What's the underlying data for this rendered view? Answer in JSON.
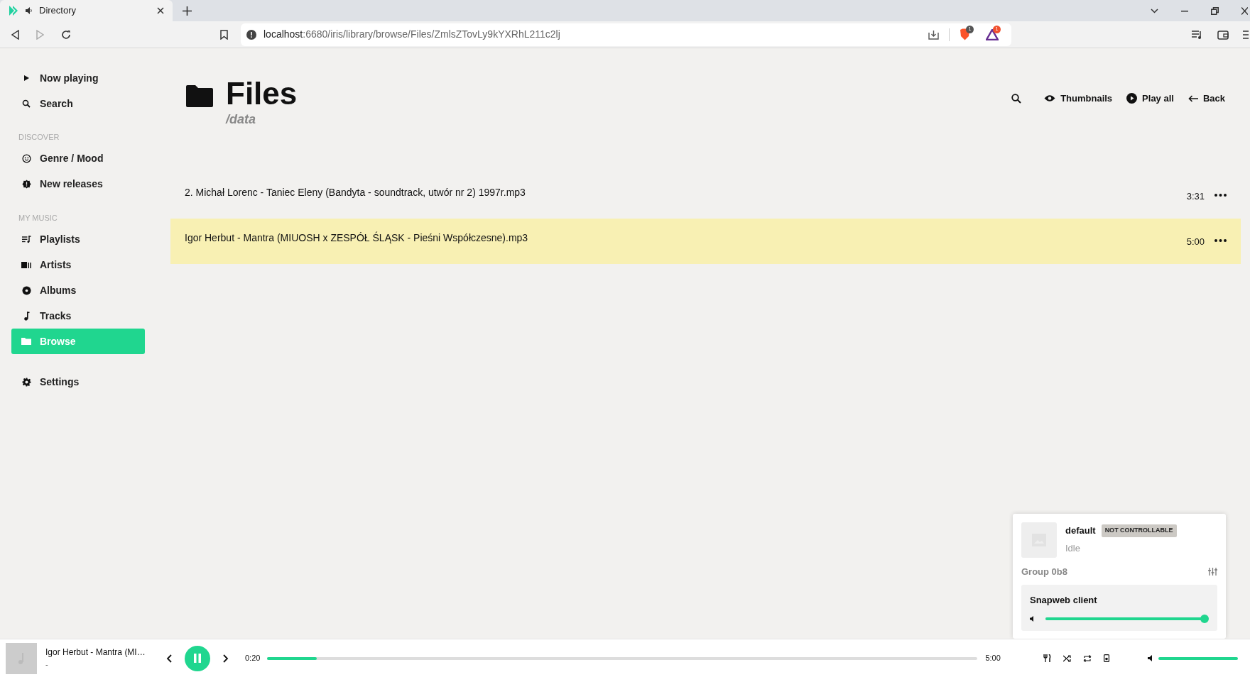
{
  "browser": {
    "tab": {
      "title": "Directory",
      "selected": true
    },
    "url": {
      "host": "localhost",
      "path": ":6680/iris/library/browse/Files/ZmlsZTovLy9kYXRhL211c2lj"
    },
    "shields_count": "1",
    "rewards_count": "1"
  },
  "sidebar": {
    "sections": [
      {
        "items": [
          {
            "label": "Now playing",
            "kind": "play",
            "selected": false
          },
          {
            "label": "Search",
            "kind": "search",
            "selected": false
          }
        ]
      },
      {
        "heading": "DISCOVER",
        "items": [
          {
            "label": "Genre / Mood",
            "kind": "smile",
            "selected": false
          },
          {
            "label": "New releases",
            "kind": "badge",
            "selected": false
          }
        ]
      },
      {
        "heading": "MY MUSIC",
        "items": [
          {
            "label": "Playlists",
            "kind": "playlist",
            "selected": false
          },
          {
            "label": "Artists",
            "kind": "artist",
            "selected": false
          },
          {
            "label": "Albums",
            "kind": "disc",
            "selected": false
          },
          {
            "label": "Tracks",
            "kind": "note",
            "selected": false
          },
          {
            "label": "Browse",
            "kind": "folder",
            "selected": true
          }
        ]
      },
      {
        "items": [
          {
            "label": "Settings",
            "kind": "gear",
            "selected": false
          }
        ]
      }
    ]
  },
  "header": {
    "title": "Files",
    "subtitle": "/data",
    "actions": [
      {
        "kind": "search"
      },
      {
        "kind": "eye",
        "label": "Thumbnails"
      },
      {
        "kind": "play",
        "label": "Play all"
      },
      {
        "kind": "back",
        "label": "Back"
      }
    ]
  },
  "tracks": [
    {
      "name": "2. Michał Lorenc - Taniec Eleny (Bandyta - soundtrack, utwór nr 2) 1997r.mp3",
      "duration": "3:31",
      "playing": false
    },
    {
      "name": "Igor Herbut - Mantra (MIUOSH x ZESPÓŁ ŚLĄSK - Pieśni Współczesne).mp3",
      "duration": "5:00",
      "playing": true
    }
  ],
  "outputs_popup": {
    "name": "default",
    "badge": "NOT CONTROLLABLE",
    "status": "Idle",
    "group": "Group 0b8",
    "client": {
      "name": "Snapweb client",
      "level": 1
    }
  },
  "player": {
    "title": "Igor Herbut - Mantra (MI…",
    "artist": "-",
    "playing": true,
    "elapsed": "0:20",
    "duration": "5:00",
    "level": 0.07,
    "volume": {
      "level": 1
    }
  }
}
